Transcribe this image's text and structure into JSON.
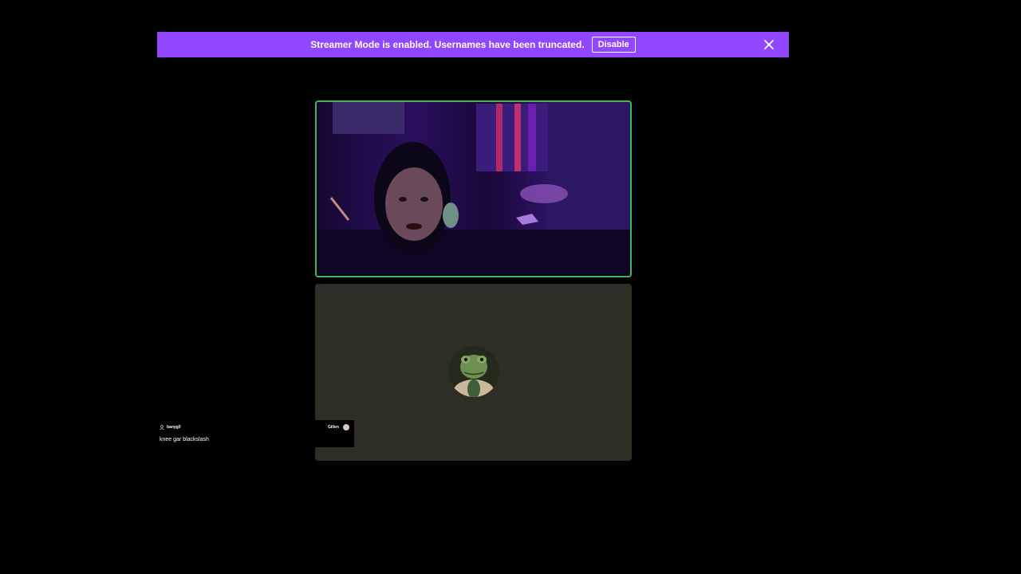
{
  "banner": {
    "message": "Streamer Mode is enabled. Usernames have been truncated.",
    "disable_label": "Disable",
    "close_icon": "close-icon",
    "color": "#9146ff"
  },
  "tiles": {
    "speaking_border_color": "#3fb950",
    "avatar_tile_color": "#2f2e26"
  },
  "overlay": {
    "user_icon": "user-icon",
    "username": "banyg0",
    "text": "knee gar blackslash"
  },
  "name_chip": {
    "name": "Gillen"
  }
}
